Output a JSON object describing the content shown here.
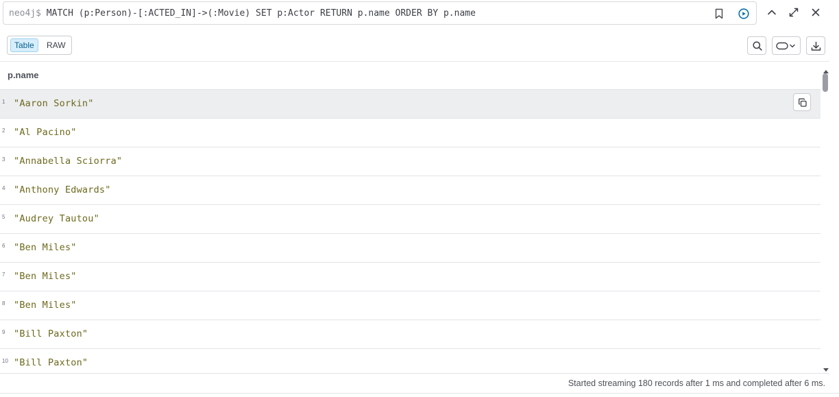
{
  "query": {
    "prompt": "neo4j$",
    "text": "MATCH (p:Person)-[:ACTED_IN]->(:Movie) SET p:Actor RETURN p.name ORDER BY p.name"
  },
  "icons": {
    "bookmark": "bookmark-icon",
    "run": "play-circle-icon",
    "collapse": "chevron-up-icon",
    "expand": "maximize-icon",
    "close": "close-icon",
    "search": "search-icon",
    "pill": "pill-dropdown-icon",
    "download": "download-icon",
    "copy": "copy-icon"
  },
  "colors": {
    "accent": "#0a5f8f",
    "string_value": "#6d6a1e"
  },
  "view_toggle": {
    "table_label": "Table",
    "raw_label": "RAW",
    "active": "Table"
  },
  "table": {
    "column_header": "p.name",
    "rows": [
      {
        "num": "1",
        "value": "\"Aaron Sorkin\""
      },
      {
        "num": "2",
        "value": "\"Al Pacino\""
      },
      {
        "num": "3",
        "value": "\"Annabella Sciorra\""
      },
      {
        "num": "4",
        "value": "\"Anthony Edwards\""
      },
      {
        "num": "5",
        "value": "\"Audrey Tautou\""
      },
      {
        "num": "6",
        "value": "\"Ben Miles\""
      },
      {
        "num": "7",
        "value": "\"Ben Miles\""
      },
      {
        "num": "8",
        "value": "\"Ben Miles\""
      },
      {
        "num": "9",
        "value": "\"Bill Paxton\""
      },
      {
        "num": "10",
        "value": "\"Bill Paxton\""
      }
    ]
  },
  "status": {
    "text": "Started streaming 180 records after 1 ms and completed after 6 ms."
  }
}
